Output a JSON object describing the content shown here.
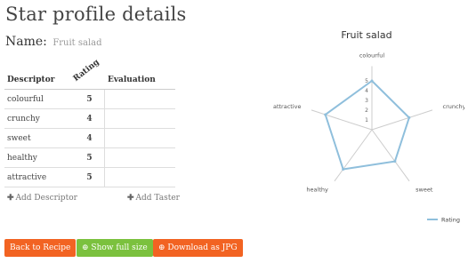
{
  "page": {
    "title": "Star profile details"
  },
  "name": {
    "label": "Name:",
    "value": "Fruit salad"
  },
  "table": {
    "headers": {
      "descriptor": "Descriptor",
      "rating": "Rating",
      "evaluation": "Evaluation"
    },
    "rows": [
      {
        "descriptor": "colourful",
        "rating": "5"
      },
      {
        "descriptor": "crunchy",
        "rating": "4"
      },
      {
        "descriptor": "sweet",
        "rating": "4"
      },
      {
        "descriptor": "healthy",
        "rating": "5"
      },
      {
        "descriptor": "attractive",
        "rating": "5"
      }
    ]
  },
  "actions": {
    "add_descriptor": "Add Descriptor",
    "add_taster": "Add Taster"
  },
  "buttons": {
    "back": "Back to Recipe",
    "show_full": "Show full size",
    "download": "Download as JPG"
  },
  "colors": {
    "orange": "#f26322",
    "green": "#7bc13e",
    "series": "#8fbfdc"
  },
  "chart_data": {
    "type": "radar",
    "title": "Fruit salad",
    "axes": [
      "colourful",
      "crunchy",
      "sweet",
      "healthy",
      "attractive"
    ],
    "scale": [
      1,
      2,
      3,
      4,
      5
    ],
    "series": [
      {
        "name": "Rating",
        "values": [
          5,
          4,
          4,
          5,
          5
        ]
      }
    ],
    "legend": "bottom-right"
  }
}
